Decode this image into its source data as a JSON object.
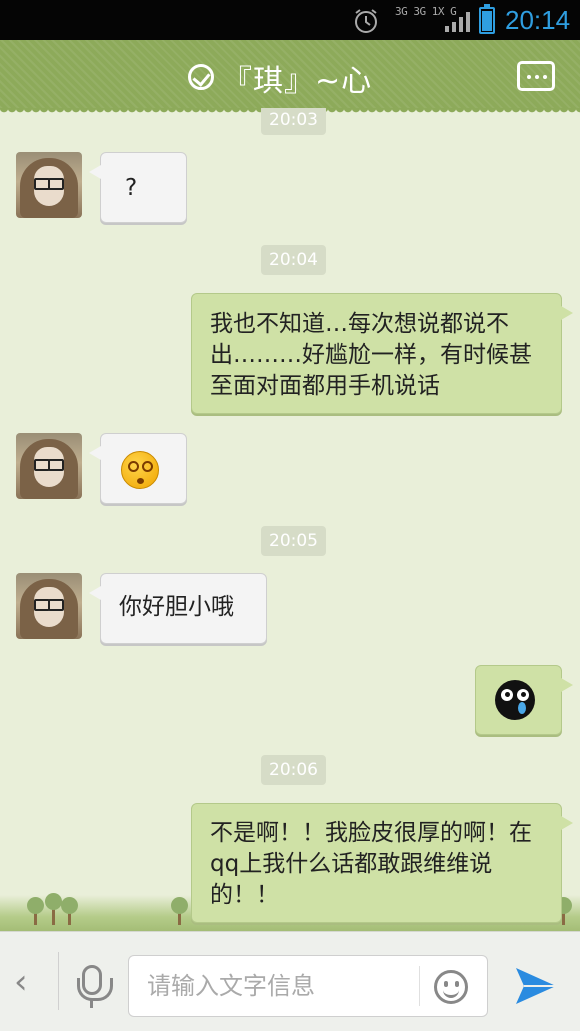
{
  "status_bar": {
    "network": "3G 3G 1X G",
    "time": "20:14",
    "battery_level": 0.85,
    "accent_color": "#2f9ee0"
  },
  "header": {
    "title": "『琪』~心",
    "status_icon": "check-circle-icon",
    "menu_icon": "more-icon",
    "color": "#8daa5a"
  },
  "messages": [
    {
      "type": "timestamp",
      "text": "20:03"
    },
    {
      "type": "incoming",
      "kind": "text",
      "text": "?"
    },
    {
      "type": "timestamp",
      "text": "20:04"
    },
    {
      "type": "outgoing",
      "kind": "text",
      "text": "我也不知道…每次想说都说不出………好尴尬一样，有时候甚至面对面都用手机说话"
    },
    {
      "type": "incoming",
      "kind": "emoji",
      "emoji": "dizzy-face-icon"
    },
    {
      "type": "timestamp",
      "text": "20:05"
    },
    {
      "type": "incoming",
      "kind": "text",
      "text": "你好胆小哦"
    },
    {
      "type": "outgoing",
      "kind": "emoji",
      "emoji": "crying-ghost-icon"
    },
    {
      "type": "timestamp",
      "text": "20:06"
    },
    {
      "type": "outgoing",
      "kind": "text",
      "text": "不是啊！！我脸皮很厚的啊！在qq上我什么话都敢跟维维说的！！"
    }
  ],
  "input_bar": {
    "back_icon": "chevron-left-icon",
    "voice_icon": "microphone-icon",
    "placeholder": "请输入文字信息",
    "emoji_icon": "smiley-icon",
    "send_icon": "send-icon"
  },
  "colors": {
    "chat_background": "#e9efd9",
    "outgoing_bubble": "#cfe1a6",
    "incoming_bubble": "#f4f4f4"
  }
}
